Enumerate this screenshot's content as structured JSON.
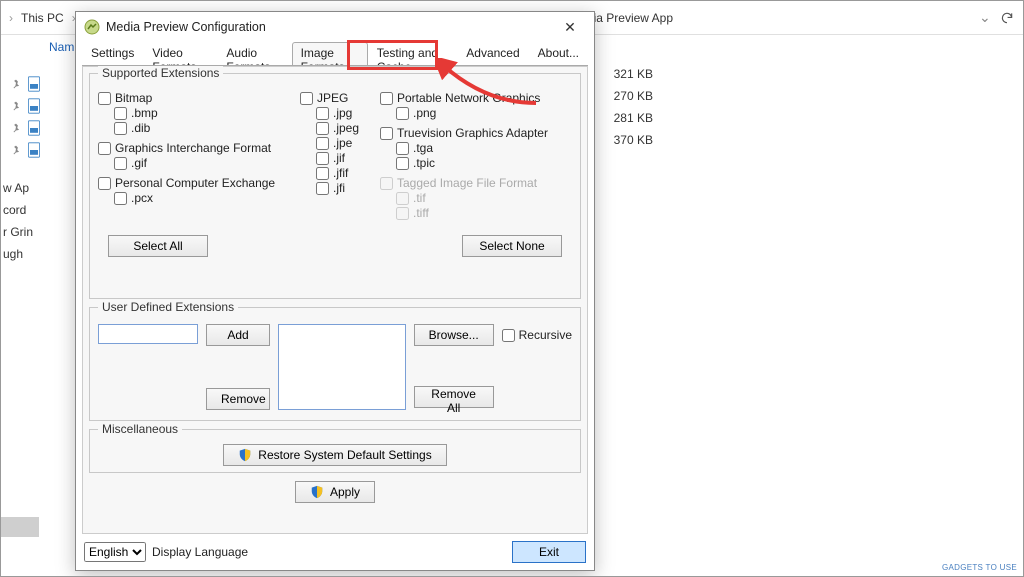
{
  "breadcrumb": {
    "this_pc": "This PC",
    "app_title": "Media Preview App"
  },
  "explorer": {
    "name_col": "Nam",
    "sizes": [
      "321 KB",
      "270 KB",
      "281 KB",
      "370 KB"
    ],
    "sidebar_items": [
      "w Ap",
      "cord",
      "r Grin",
      "ugh"
    ]
  },
  "dialog": {
    "title": "Media Preview Configuration",
    "tabs": [
      "Settings",
      "Video Formats",
      "Audio Formats",
      "Image Formats",
      "Testing and Cache",
      "Advanced",
      "About..."
    ],
    "active_tab_index": 3,
    "supported": {
      "group_title": "Supported Extensions",
      "col1": {
        "h1": "Bitmap",
        "h1_ext": [
          ".bmp",
          ".dib"
        ],
        "h2": "Graphics Interchange Format",
        "h2_ext": [
          ".gif"
        ],
        "h3": "Personal Computer Exchange",
        "h3_ext": [
          ".pcx"
        ]
      },
      "col2": {
        "h1": "JPEG",
        "h1_ext": [
          ".jpg",
          ".jpeg",
          ".jpe",
          ".jif",
          ".jfif",
          ".jfi"
        ]
      },
      "col3": {
        "h1": "Portable Network Graphics",
        "h1_ext": [
          ".png"
        ],
        "h2": "Truevision Graphics Adapter",
        "h2_ext": [
          ".tga",
          ".tpic"
        ],
        "h3": "Tagged Image File Format",
        "h3_ext": [
          ".tif",
          ".tiff"
        ]
      },
      "select_all": "Select All",
      "select_none": "Select None"
    },
    "userdef": {
      "group_title": "User Defined Extensions",
      "add": "Add",
      "remove": "Remove",
      "browse": "Browse...",
      "remove_all": "Remove All",
      "recursive": "Recursive"
    },
    "misc": {
      "group_title": "Miscellaneous",
      "restore": "Restore System Default Settings"
    },
    "apply": "Apply",
    "lang_value": "English",
    "lang_label": "Display Language",
    "exit": "Exit"
  },
  "watermark": "GADGETS TO USE"
}
